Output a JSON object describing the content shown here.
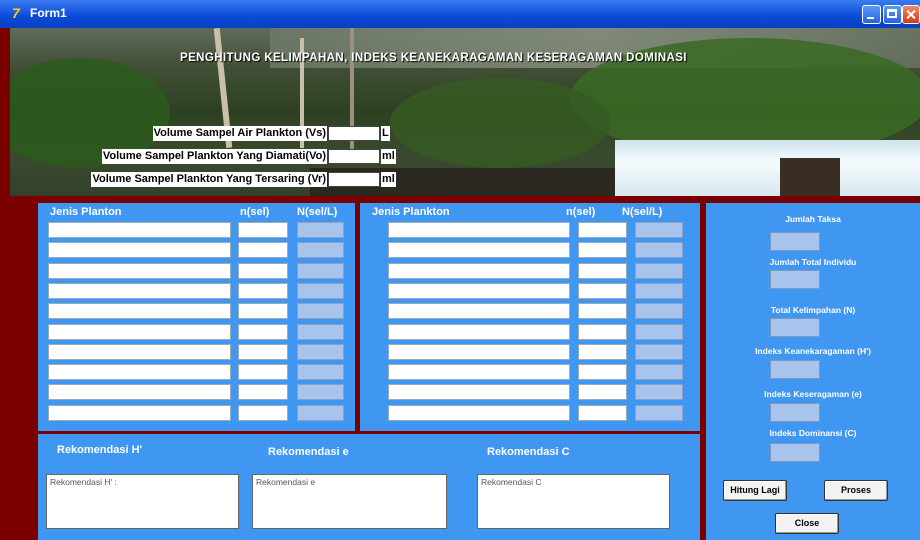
{
  "window": {
    "title": "Form1"
  },
  "banner": {
    "heading": "PENGHITUNG KELIMPAHAN, INDEKS KEANEKARAGAMAN KESERAGAMAN  DOMINASI",
    "fields": [
      {
        "label": "Volume Sampel Air Plankton (Vs)",
        "unit": "L",
        "value": ""
      },
      {
        "label": "Volume Sampel Plankton Yang Diamati(Vo)",
        "unit": "ml",
        "value": ""
      },
      {
        "label": "Volume Sampel Plankton Yang Tersaring (Vr)",
        "unit": "ml",
        "value": ""
      }
    ]
  },
  "table_left": {
    "col_jenis": "Jenis Planton",
    "col_n": "n(sel)",
    "col_N": "N(sel/L)"
  },
  "table_right": {
    "col_jenis": "Jenis Plankton",
    "col_n": "n(sel)",
    "col_N": "N(sel/L)"
  },
  "recommendations": {
    "h": {
      "title": "Rekomendasi H'",
      "text": "Rekomendasi H' :"
    },
    "e": {
      "title": "Rekomendasi e",
      "text": "Rekomendasi e"
    },
    "c": {
      "title": "Rekomendasi C",
      "text": "Rekomendasi C"
    }
  },
  "summary": {
    "jumlah_taksa": "Jumlah Taksa",
    "jumlah_individu": "Jumlah Total Individu",
    "total_kelimpahan": "Total Kelimpahan (N)",
    "indeks_keanekaragaman": "Indeks Keanekaragaman (H')",
    "indeks_keseragaman": "Indeks Keseragaman (e)",
    "indeks_dominansi": "Indeks Dominansi (C)"
  },
  "buttons": {
    "hitung_lagi": "Hitung Lagi",
    "proses": "Proses",
    "close": "Close"
  },
  "colors": {
    "panel": "#3f97f2",
    "frame": "#7a0000",
    "readonly": "#a9c4ec"
  }
}
